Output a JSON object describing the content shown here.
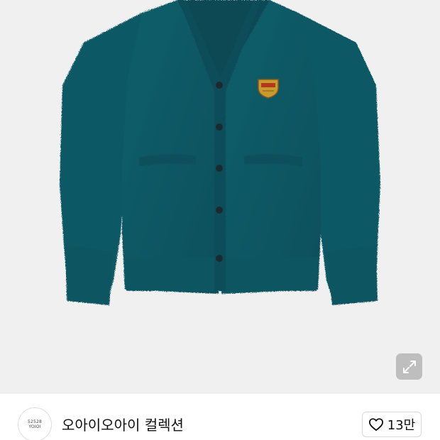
{
  "product": {
    "image_alt": "teal fuzzy v-neck cardigan with crest patch",
    "colors": {
      "background": "#f0f0f0",
      "knit": "#0f5d68",
      "button": "#1b2a2e",
      "crest": "#d8a63a"
    }
  },
  "expand_button": {
    "icon": "expand-arrows-icon"
  },
  "store": {
    "avatar_line1": "52528",
    "avatar_line2": "YOIOI",
    "name": "오아이오아이 컬렉션"
  },
  "like": {
    "icon": "heart-outline-icon",
    "count": "13만"
  }
}
